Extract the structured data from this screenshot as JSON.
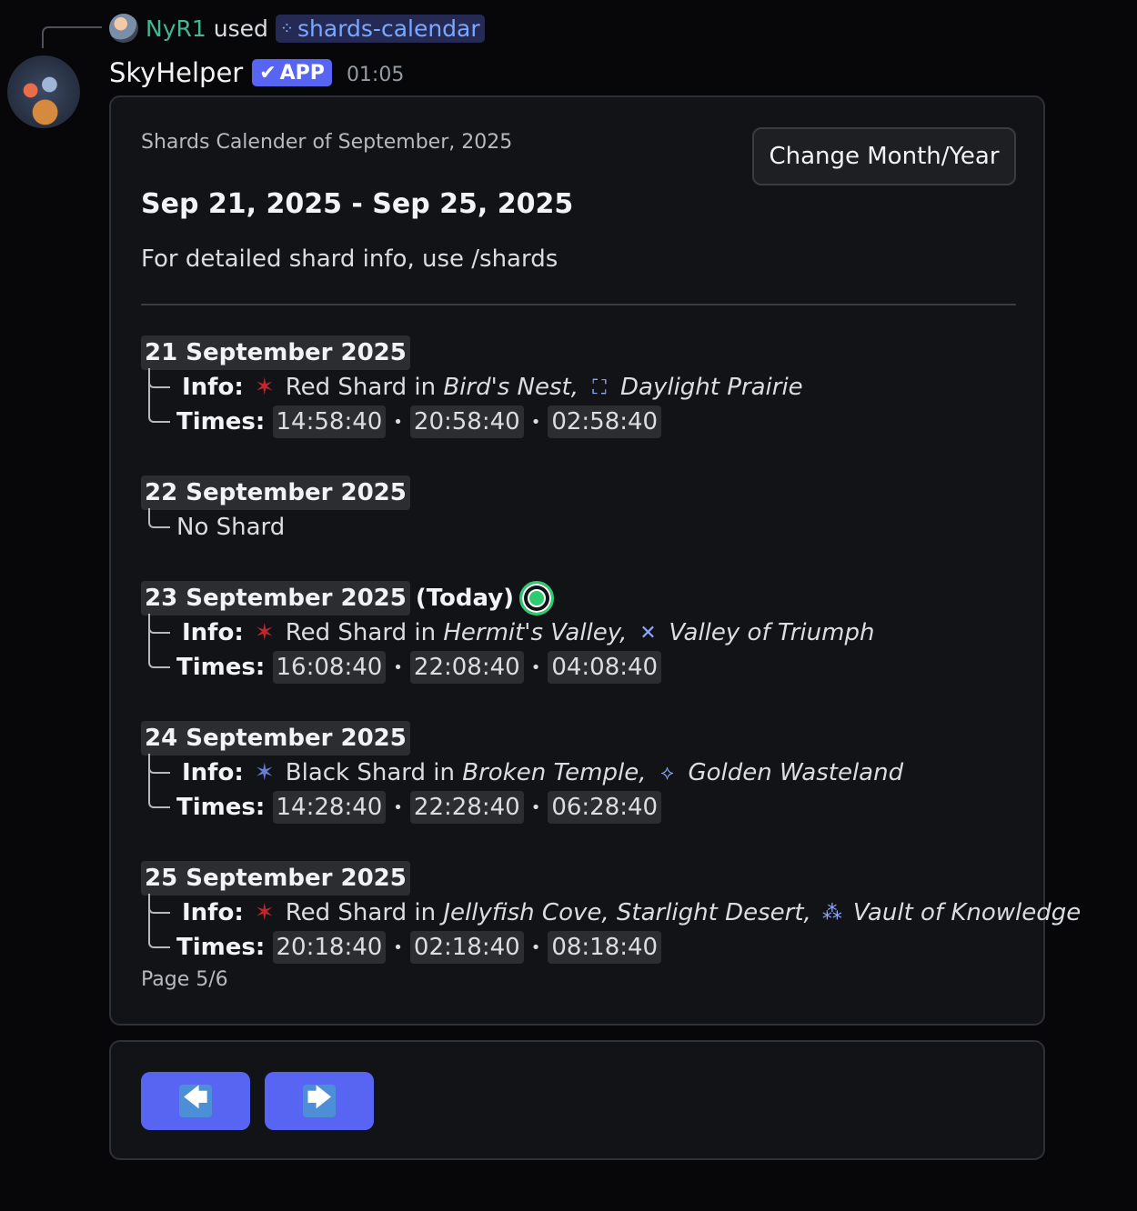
{
  "reply": {
    "user": "NyR1",
    "used": "used",
    "command": "shards-calendar"
  },
  "message": {
    "bot_name": "SkyHelper",
    "app_badge": "APP",
    "timestamp": "01:05"
  },
  "embed": {
    "subtitle": "Shards Calender of September, 2025",
    "change_button": "Change Month/Year",
    "title": "Sep 21, 2025 - Sep 25, 2025",
    "description": "For detailed shard info, use /shards",
    "footer": "Page 5/6",
    "info_label": "Info:",
    "times_label": "Times:",
    "days": [
      {
        "date": "21 September 2025",
        "shard": "Red Shard",
        "in": "in",
        "location": "Bird's Nest,",
        "realm": "Daylight Prairie",
        "times": [
          "14:58:40",
          "20:58:40",
          "02:58:40"
        ]
      },
      {
        "date": "22 September 2025",
        "no_shard": "No Shard"
      },
      {
        "date": "23 September 2025",
        "today": "(Today)",
        "shard": "Red Shard",
        "in": "in",
        "location": "Hermit's Valley,",
        "realm": "Valley of Triumph",
        "times": [
          "16:08:40",
          "22:08:40",
          "04:08:40"
        ]
      },
      {
        "date": "24 September 2025",
        "shard": "Black Shard",
        "in": "in",
        "location": "Broken Temple,",
        "realm": "Golden Wasteland",
        "times": [
          "14:28:40",
          "22:28:40",
          "06:28:40"
        ]
      },
      {
        "date": "25 September 2025",
        "shard": "Red Shard",
        "in": "in",
        "location": "Jellyfish Cove, Starlight Desert,",
        "realm": "Vault of Knowledge",
        "times": [
          "20:18:40",
          "02:18:40",
          "08:18:40"
        ]
      }
    ]
  },
  "nav": {
    "prev_icon": "left-arrow-icon",
    "next_icon": "right-arrow-icon",
    "prev_glyph": "🡄",
    "next_glyph": "🡆"
  },
  "colors": {
    "accent": "#5865f2",
    "username": "#43b88e",
    "today": "#2ecc71"
  }
}
